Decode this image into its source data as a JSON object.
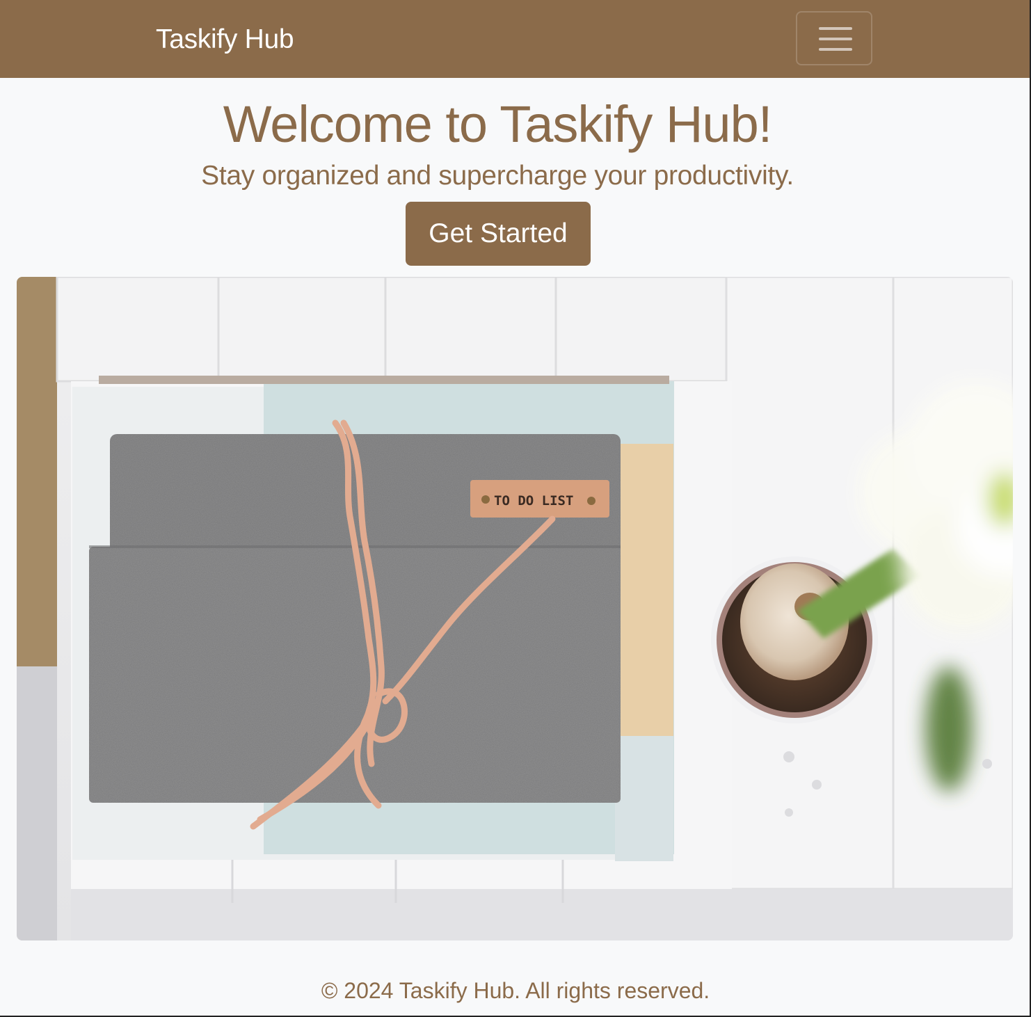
{
  "navbar": {
    "brand": "Taskify Hub",
    "toggler_icon": "hamburger-menu-icon",
    "background_color": "#8b6b4a"
  },
  "hero": {
    "title": "Welcome to Taskify Hub!",
    "subtitle": "Stay organized and supercharge your productivity.",
    "cta_label": "Get Started",
    "accent_color": "#8b6b4a"
  },
  "footer": {
    "text": "© 2024 Taskify Hub. All rights reserved."
  },
  "photo_label": {
    "text": "TO DO LIST"
  }
}
